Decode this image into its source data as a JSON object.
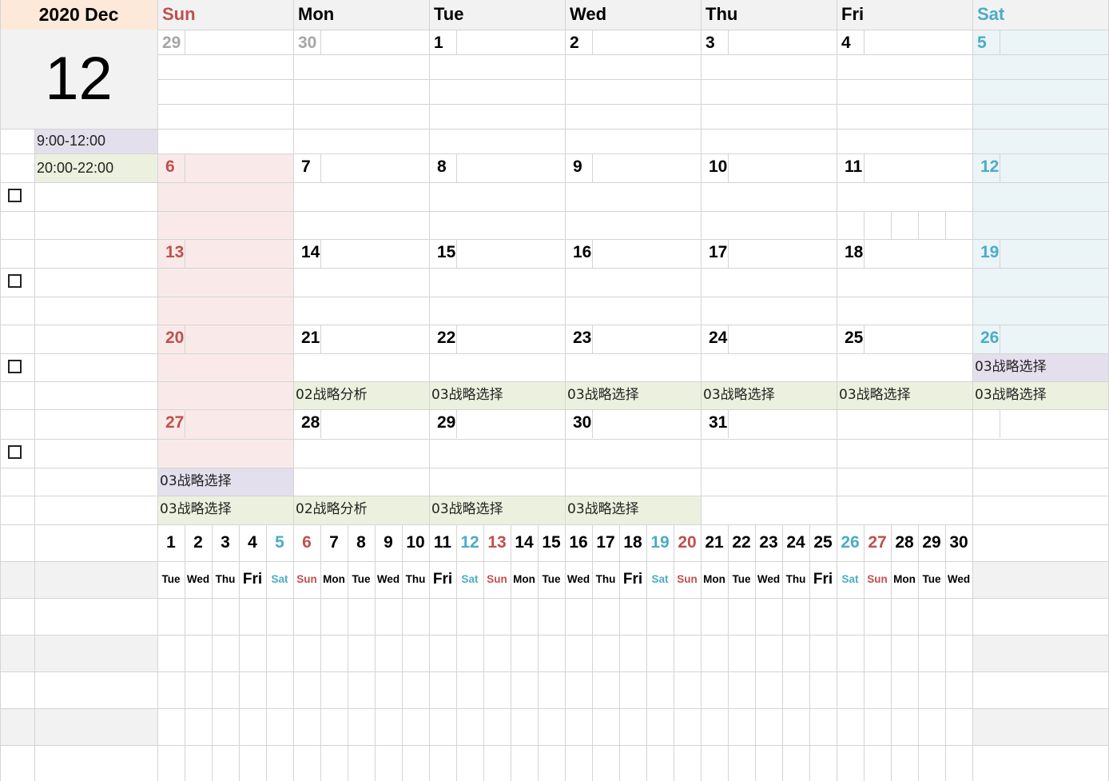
{
  "header": {
    "year_month": "2020 Dec",
    "big_month": "12"
  },
  "time_slots": [
    "9:00-12:00",
    "20:00-22:00"
  ],
  "weekdays": [
    "Sun",
    "Mon",
    "Tue",
    "Wed",
    "Thu",
    "Fri",
    "Sat"
  ],
  "weeks": [
    [
      "29",
      "30",
      "1",
      "2",
      "3",
      "4",
      "5"
    ],
    [
      "6",
      "7",
      "8",
      "9",
      "10",
      "11",
      "12"
    ],
    [
      "13",
      "14",
      "15",
      "16",
      "17",
      "18",
      "19"
    ],
    [
      "20",
      "21",
      "22",
      "23",
      "24",
      "25",
      "26"
    ],
    [
      "27",
      "28",
      "29",
      "30",
      "31",
      "",
      ""
    ]
  ],
  "events": {
    "sat26_top": "03战略选择",
    "week4_bottom": [
      "02战略分析",
      "03战略选择",
      "03战略选择",
      "03战略选择",
      "03战略选择",
      "03战略选择"
    ],
    "sun27_top": "03战略选择",
    "week5_bottom": [
      "03战略选择",
      "02战略分析",
      "03战略选择",
      "03战略选择"
    ]
  },
  "strip": {
    "numbers": [
      "1",
      "2",
      "3",
      "4",
      "5",
      "6",
      "7",
      "8",
      "9",
      "10",
      "11",
      "12",
      "13",
      "14",
      "15",
      "16",
      "17",
      "18",
      "19",
      "20",
      "21",
      "22",
      "23",
      "24",
      "25",
      "26",
      "27",
      "28",
      "29",
      "30"
    ],
    "dows": [
      "Tue",
      "Wed",
      "Thu",
      "Fri",
      "Sat",
      "Sun",
      "Mon",
      "Tue",
      "Wed",
      "Thu",
      "Fri",
      "Sat",
      "Sun",
      "Mon",
      "Tue",
      "Wed",
      "Thu",
      "Fri",
      "Sat",
      "Sun",
      "Mon",
      "Tue",
      "Wed",
      "Thu",
      "Fri",
      "Sat",
      "Sun",
      "Mon",
      "Tue",
      "Wed"
    ]
  },
  "colors": {
    "weekday": "#000000",
    "sunday": "#c0504d",
    "saturday": "#4bacc6",
    "other_month": "#a6a6a6",
    "header_bg": "#f2f2f2",
    "month_header_bg": "#fde9d9",
    "sun_bg": "#f9eae9",
    "sat_bg": "#ebf4f7",
    "event_purple": "#e4dfec",
    "event_green": "#ebf1de"
  }
}
